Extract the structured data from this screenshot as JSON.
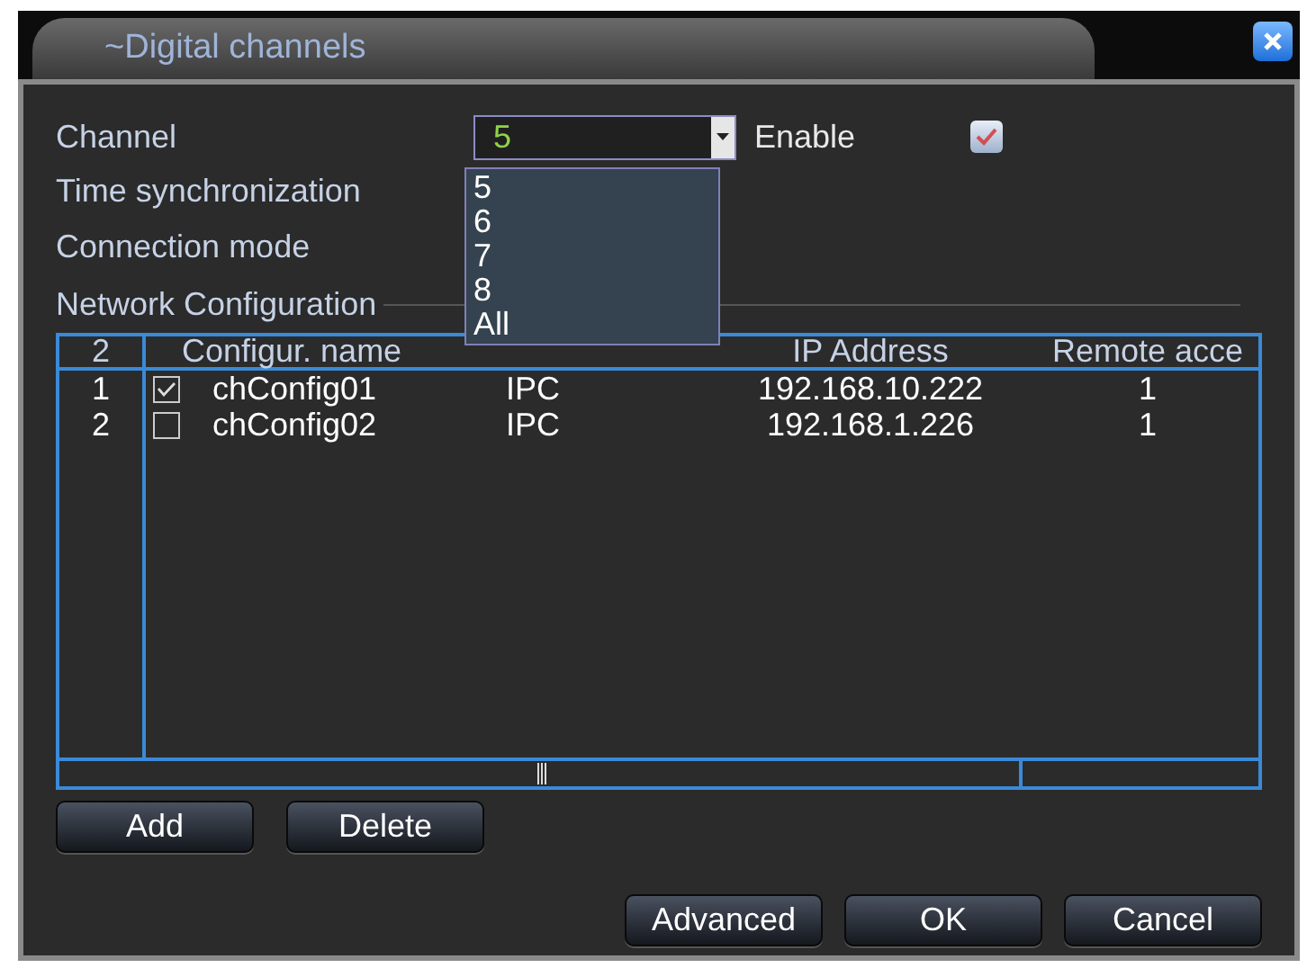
{
  "window": {
    "title": "~Digital channels"
  },
  "form": {
    "channel_label": "Channel",
    "channel_value": "5",
    "enable_label": "Enable",
    "enable_checked": true,
    "time_sync_label": "Time synchronization",
    "connection_mode_label": "Connection mode",
    "network_config_label": "Network Configuration"
  },
  "dropdown": {
    "options": [
      {
        "label": "5",
        "selected": false
      },
      {
        "label": "6",
        "selected": false
      },
      {
        "label": "7",
        "selected": false
      },
      {
        "label": "8",
        "selected": false
      },
      {
        "label": "All",
        "selected": false
      }
    ]
  },
  "table": {
    "count": "2",
    "columns": [
      "Configur. name",
      "",
      "IP Address",
      "Remote acce"
    ],
    "rows": [
      {
        "index": "1",
        "checked": true,
        "name": "chConfig01",
        "column_3": "IPC",
        "ip": "192.168.10.222",
        "remote": "1"
      },
      {
        "index": "2",
        "checked": false,
        "name": "chConfig02",
        "column_3": "IPC",
        "ip": "192.168.1.226",
        "remote": "1"
      }
    ]
  },
  "buttons_left": [
    "Add",
    "Delete"
  ],
  "buttons_right": [
    "Advanced",
    "OK",
    "Cancel"
  ]
}
